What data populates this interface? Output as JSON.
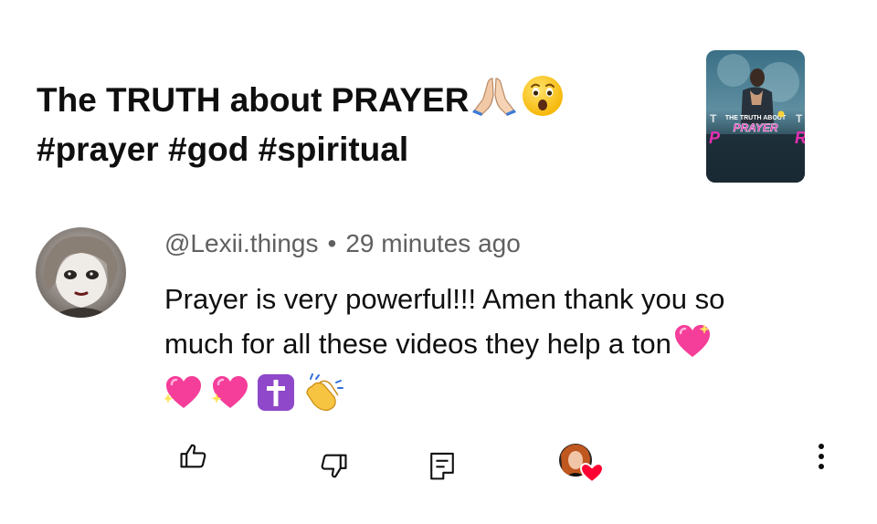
{
  "video": {
    "title_line1": "The TRUTH about PRAYER",
    "title_line2": "#prayer #god #spiritual",
    "title_emojis": [
      "folded-hands-emoji",
      "astonished-face-emoji"
    ],
    "thumbnail": {
      "caption_top": "THE TRUTH ABOUT",
      "caption_main": "PRAYER"
    }
  },
  "comment": {
    "author": "@Lexii.things",
    "separator": "•",
    "time": "29 minutes ago",
    "text_line1": "Prayer is very powerful!!! Amen thank you so",
    "text_line2": "much for all these videos they help a ton",
    "trailing_emojis": [
      "sparkling-heart-emoji",
      "sparkling-heart-emoji",
      "sparkling-heart-emoji",
      "latin-cross-emoji",
      "clapping-hands-emoji"
    ]
  },
  "actions": {
    "like_icon": "thumbs-up-icon",
    "dislike_icon": "thumbs-down-icon",
    "reply_icon": "reply-icon",
    "creator_heart_icon": "creator-heart-icon",
    "more_icon": "more-vertical-icon"
  },
  "colors": {
    "text_primary": "#0f0f0f",
    "text_secondary": "#606060",
    "heart_red": "#ff0033",
    "thumbnail_pink": "#e62fb4"
  }
}
